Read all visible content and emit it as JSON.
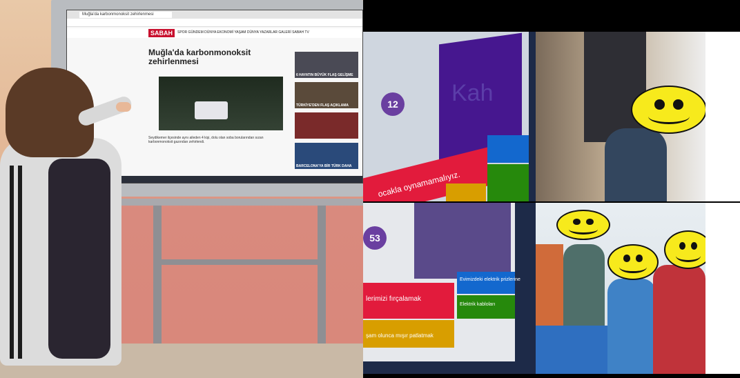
{
  "left_photo": {
    "browser_tab": "Muğla'da karbonmonoksit zehirlenmesi",
    "site_logo": "SABAH",
    "nav_links": "SPOR  GÜNDEM  DÜNYA  EKONOMİ  YAŞAM  DÜNYA  YAZARLAR  GALERİ  SABAH TV",
    "headline": "Muğla'da karbonmonoksit zehirlenmesi",
    "summary": "Seydikemer ilçesinde aynı aileden 4 kişi, dolu olan soba borularından sızan karbonmonoksit gazından zehirlendi.",
    "thumb_captions": [
      "6 HAYATIN BÜYÜK FLAŞ GELİŞME",
      "TÜRKİYE'DEN FLAŞ AÇIKLAMA",
      "",
      "BARCELONA'YA BİR TÜRK DAHA"
    ]
  },
  "right_collage": {
    "top_question_number": "12",
    "top_brand_text": "Kah",
    "top_answer_text": "ocakla oynamamalıyız.",
    "bottom_question_number": "53",
    "bottom_answer_left": "lerimizi fırçalamak",
    "bottom_answer_left2": "şam olunca mışır patlatmak",
    "bottom_answer_right": "Evimizdeki elektrik prizlerine",
    "bottom_answer_right2": "Elektrik kabloları"
  },
  "colors": {
    "kahoot_red": "#e21b3c",
    "kahoot_blue": "#1368ce",
    "kahoot_yellow": "#d89e00",
    "kahoot_green": "#26890c",
    "kahoot_purple": "#46178f",
    "smiley_yellow": "#f7ea1c"
  }
}
